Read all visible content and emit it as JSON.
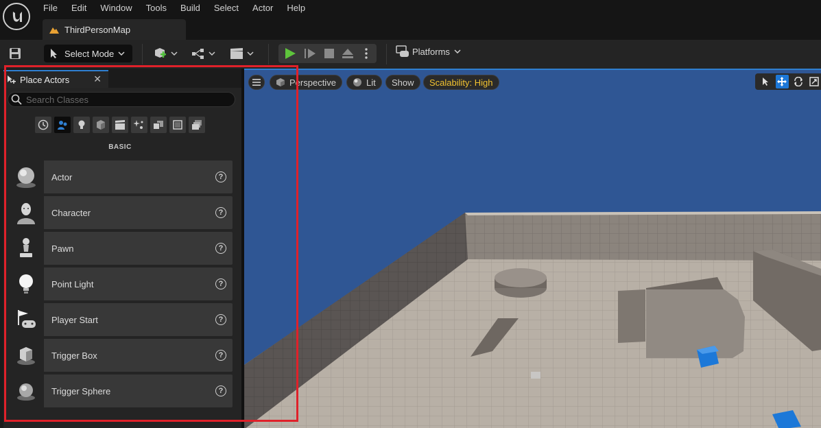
{
  "menubar": {
    "items": [
      "File",
      "Edit",
      "Window",
      "Tools",
      "Build",
      "Select",
      "Actor",
      "Help"
    ],
    "map_tab": "ThirdPersonMap"
  },
  "toolbar": {
    "select_mode": "Select Mode",
    "platforms": "Platforms"
  },
  "place_actors": {
    "title": "Place Actors",
    "search_placeholder": "Search Classes",
    "section": "BASIC",
    "items": [
      {
        "label": "Actor",
        "icon": "sphere-actor-icon"
      },
      {
        "label": "Character",
        "icon": "character-icon"
      },
      {
        "label": "Pawn",
        "icon": "pawn-icon"
      },
      {
        "label": "Point Light",
        "icon": "light-bulb-icon"
      },
      {
        "label": "Player Start",
        "icon": "flag-gamepad-icon"
      },
      {
        "label": "Trigger Box",
        "icon": "trigger-box-icon"
      },
      {
        "label": "Trigger Sphere",
        "icon": "trigger-sphere-icon"
      }
    ]
  },
  "viewport": {
    "perspective": "Perspective",
    "lit": "Lit",
    "show": "Show",
    "scalability": "Scalability: High"
  },
  "colors": {
    "accent": "#2f7fd1",
    "play": "#5ec43c",
    "highlight": "#e0212a",
    "sky": "#2f5694",
    "scalability": "#f2c230"
  }
}
